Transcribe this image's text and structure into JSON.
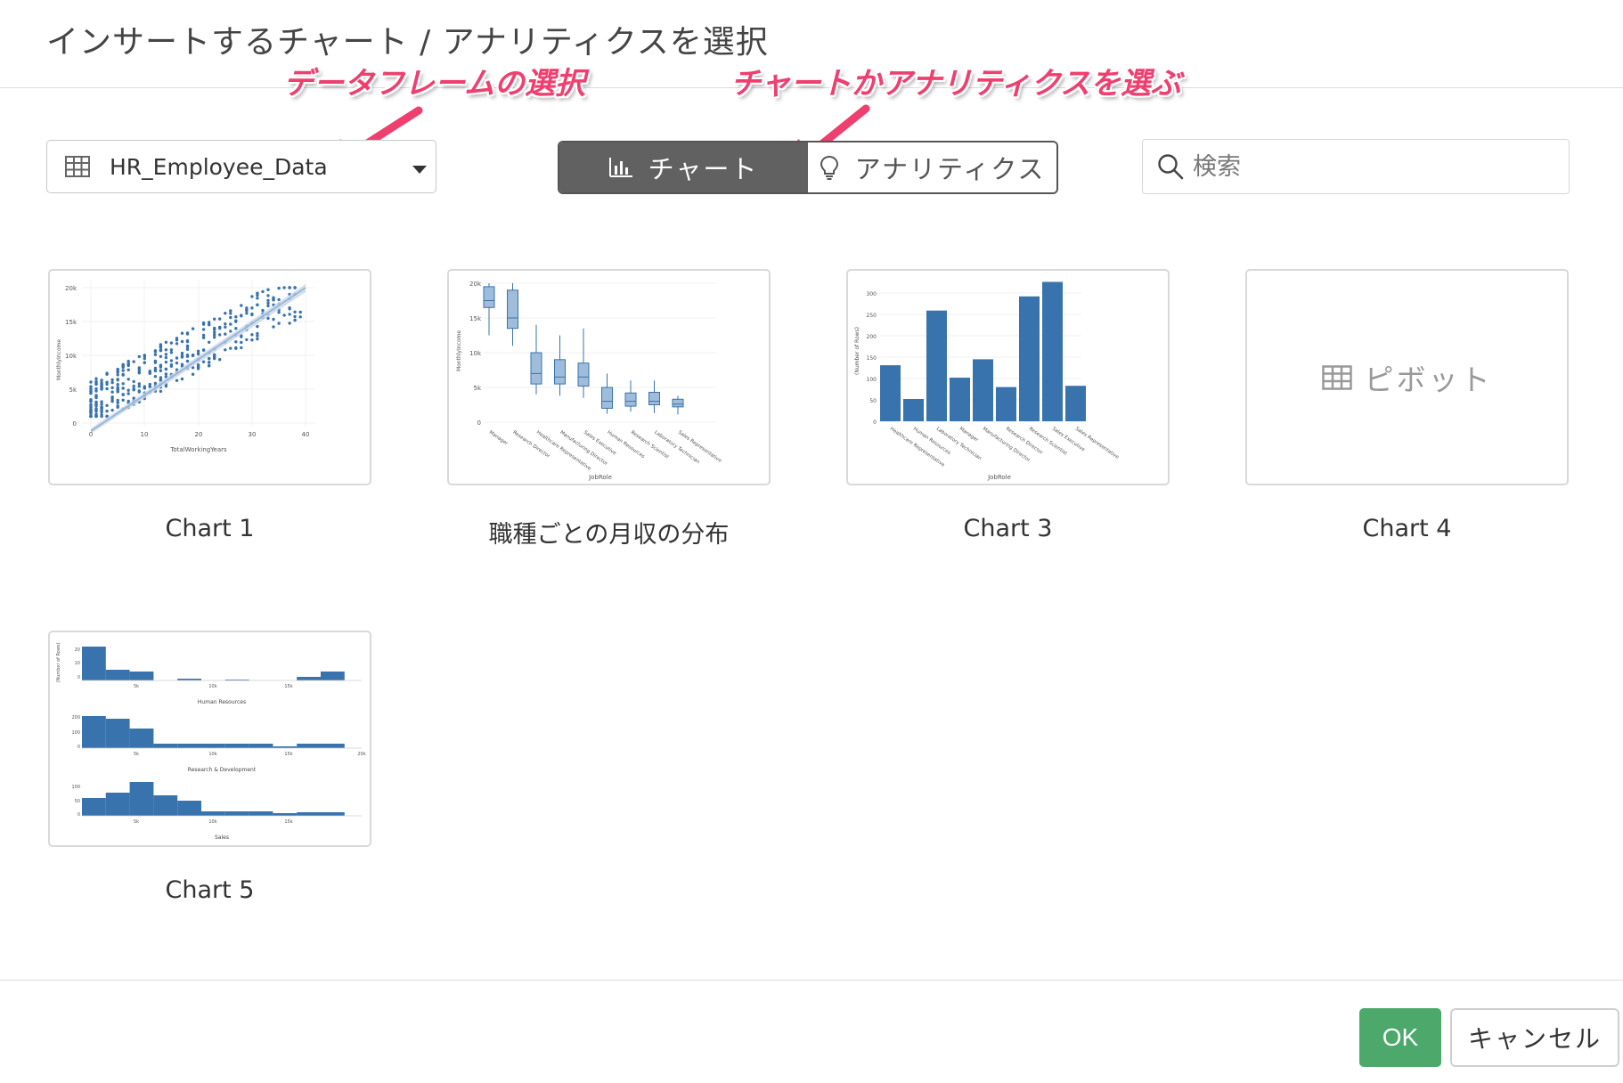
{
  "dialog": {
    "title": "インサートするチャート / アナリティクスを選択"
  },
  "annotations": {
    "dataframe_note": "データフレームの選択",
    "type_note": "チャートかアナリティクスを選ぶ",
    "color": "#ef3f6f"
  },
  "dataframe_select": {
    "icon": "table-grid-icon",
    "value": "HR_Employee_Data"
  },
  "type_toggle": {
    "chart_label": "チャート",
    "chart_icon": "bar-chart-icon",
    "analytics_label": "アナリティクス",
    "analytics_icon": "lightbulb-icon",
    "selected": "チャート"
  },
  "search": {
    "icon": "search-icon",
    "placeholder": "検索"
  },
  "cards": [
    {
      "label": "Chart 1",
      "thumbnail": "scatter"
    },
    {
      "label": "職種ごとの月収の分布",
      "thumbnail": "boxplot"
    },
    {
      "label": "Chart 3",
      "thumbnail": "bar"
    },
    {
      "label": "Chart 4",
      "thumbnail": "pivot",
      "pivot_text": "ピボット"
    },
    {
      "label": "Chart 5",
      "thumbnail": "histogram"
    }
  ],
  "thumbs": {
    "scatter": {
      "xlabel": "TotalWorkingYears",
      "ylabel": "MonthlyIncome",
      "xticks": [
        "0",
        "10",
        "20",
        "30",
        "40"
      ],
      "yticks": [
        "0",
        "5k",
        "10k",
        "15k",
        "20k"
      ]
    },
    "box": {
      "xlabel": "JobRole",
      "ylabel": "MonthlyIncome",
      "yticks": [
        "0",
        "5k",
        "10k",
        "15k",
        "20k"
      ],
      "categories": [
        "Manager",
        "Research Director",
        "Healthcare Representative",
        "Manufacturing Director",
        "Sales Executive",
        "Human Resources",
        "Research Scientist",
        "Laboratory Technician",
        "Sales Representative"
      ]
    },
    "bar": {
      "xlabel": "JobRole",
      "ylabel": "(Number of Rows)",
      "yticks": [
        "0",
        "50",
        "100",
        "150",
        "200",
        "250",
        "300"
      ],
      "categories": [
        "Healthcare Representative",
        "Human Resources",
        "Laboratory Technician",
        "Manager",
        "Manufacturing Director",
        "Research Director",
        "Research Scientist",
        "Sales Executive",
        "Sales Representative"
      ]
    },
    "hist": {
      "ylabel": "(Number of Rows)",
      "facets": [
        "Human Resources",
        "Research & Development",
        "Sales"
      ],
      "xticks": [
        "5k",
        "10k",
        "15k",
        "20k"
      ],
      "yticks_hr": [
        "0",
        "10",
        "20"
      ],
      "yticks_rd": [
        "0",
        "100",
        "200"
      ],
      "yticks_sales": [
        "0",
        "50",
        "100"
      ]
    }
  },
  "footer": {
    "ok_label": "OK",
    "cancel_label": "キャンセル",
    "ok_color": "#4ca86b"
  }
}
